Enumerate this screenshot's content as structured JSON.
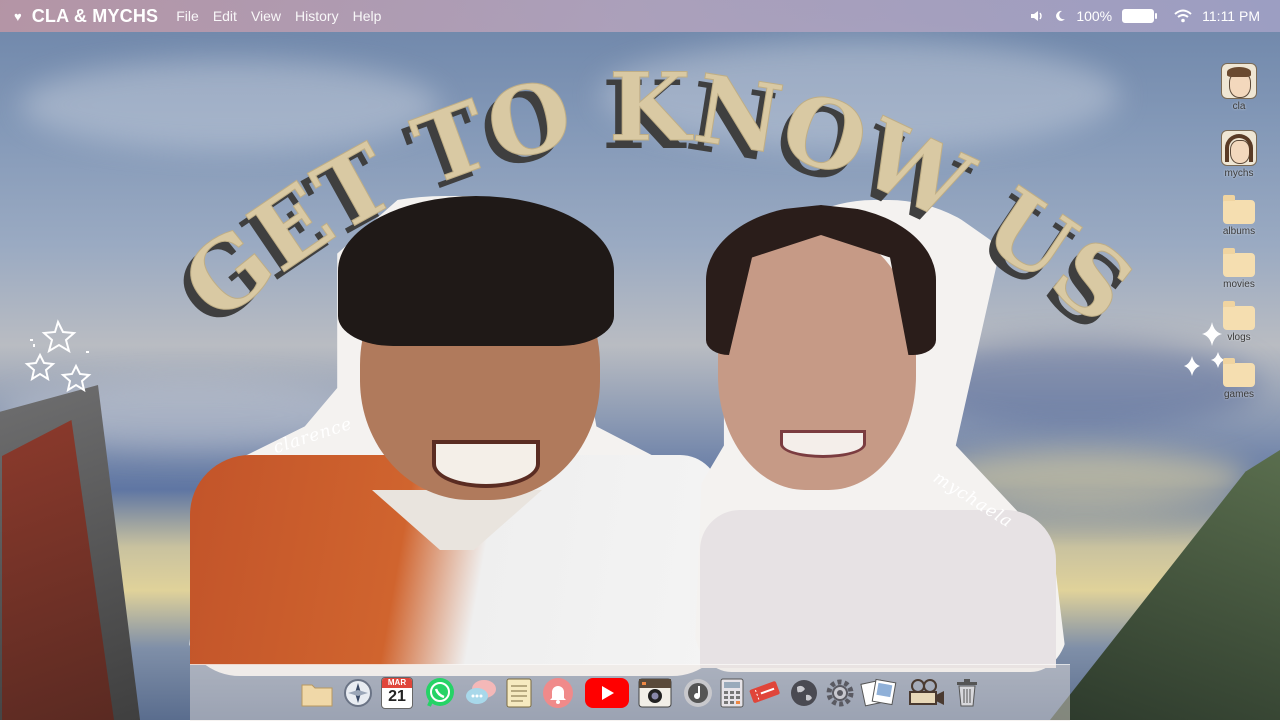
{
  "menubar": {
    "app_name": "CLA & MYCHS",
    "menus": [
      "File",
      "Edit",
      "View",
      "History",
      "Help"
    ],
    "battery": "100%",
    "clock": "11:11 PM"
  },
  "title": "GET TO KNOW US",
  "people": [
    {
      "name": "clarence"
    },
    {
      "name": "mychaela"
    }
  ],
  "desktop_icons": [
    {
      "label": "cla",
      "icon": "avatar-cla-icon"
    },
    {
      "label": "mychs",
      "icon": "avatar-mychs-icon"
    },
    {
      "label": "albums",
      "icon": "folder-icon"
    },
    {
      "label": "movies",
      "icon": "folder-icon"
    },
    {
      "label": "vlogs",
      "icon": "folder-icon"
    },
    {
      "label": "games",
      "icon": "folder-icon"
    }
  ],
  "dock": {
    "calendar_month": "MAR",
    "calendar_day": "21",
    "items": [
      "finder-icon",
      "compass-icon",
      "calendar-icon",
      "whatsapp-icon",
      "messages-icon",
      "notes-icon",
      "notification-bell-icon",
      "youtube-icon",
      "camera-icon",
      "music-icon",
      "calculator-icon",
      "tickets-icon",
      "globe-icon",
      "settings-icon",
      "photos-icon",
      "video-camera-icon",
      "trash-icon"
    ]
  },
  "colors": {
    "title_fill": "#d9c9a3",
    "title_shadow": "#3f3f3f",
    "youtube_red": "#ff0000",
    "whatsapp_green": "#25d366"
  }
}
